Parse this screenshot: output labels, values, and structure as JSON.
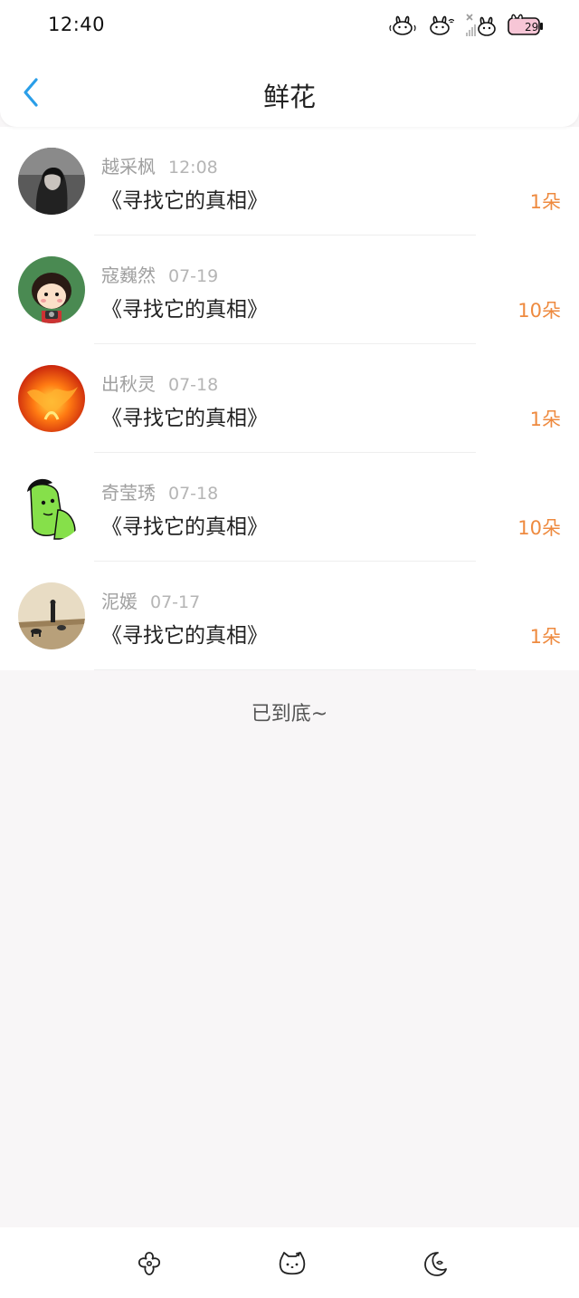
{
  "status_bar": {
    "time": "12:40",
    "icons": [
      "bunny-sound-icon",
      "bunny-wifi-icon",
      "bunny-signal-icon",
      "bunny-battery-icon"
    ]
  },
  "header": {
    "back_icon": "chevron-left-icon",
    "title": "鲜花"
  },
  "flowers": [
    {
      "name": "越采枫",
      "time": "12:08",
      "title": "《寻找它的真相》",
      "amount": "1朵"
    },
    {
      "name": "寇巍然",
      "time": "07-19",
      "title": "《寻找它的真相》",
      "amount": "10朵"
    },
    {
      "name": "出秋灵",
      "time": "07-18",
      "title": "《寻找它的真相》",
      "amount": "1朵"
    },
    {
      "name": "奇莹琇",
      "time": "07-18",
      "title": "《寻找它的真相》",
      "amount": "10朵"
    },
    {
      "name": "泥媛",
      "time": "07-17",
      "title": "《寻找它的真相》",
      "amount": "1朵"
    }
  ],
  "footer_text": "已到底~",
  "bottom_nav": {
    "items": [
      "flower-icon",
      "hello-kitty-icon",
      "moon-icon"
    ]
  },
  "colors": {
    "accent_blue": "#2a9ee8",
    "amount_orange": "#ee8a3f",
    "background": "#f8f6f7"
  }
}
